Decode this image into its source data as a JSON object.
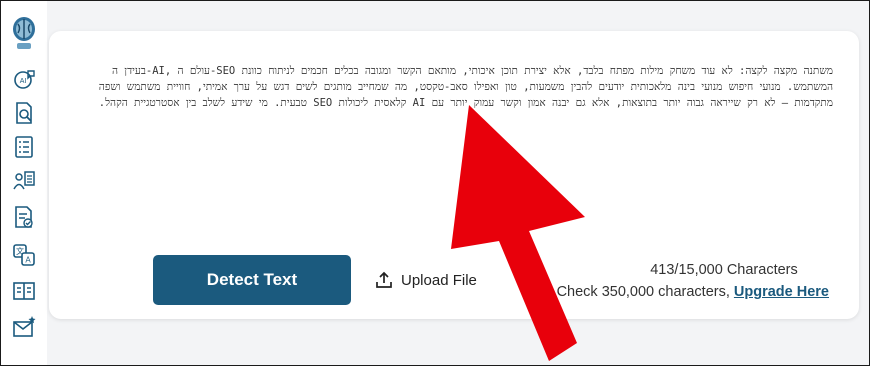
{
  "sidebar": {
    "icons": [
      {
        "name": "ai-chat-icon"
      },
      {
        "name": "document-search-icon"
      },
      {
        "name": "checklist-icon"
      },
      {
        "name": "user-document-icon"
      },
      {
        "name": "document-check-icon"
      },
      {
        "name": "translate-icon"
      },
      {
        "name": "compare-icon"
      },
      {
        "name": "mail-star-icon"
      }
    ]
  },
  "editor": {
    "text": "משתנה מקצה לקצה: לא עוד משחק מילות מפתח בלבד, אלא יצירת תוכן איכותי, מותאם הקשר ומגובה בכלים חכמים לניתוח כוונת SEO-עולם ה ,AI-בעידן ה המשתמש. מנועי חיפוש מנועי בינה מלאכותית יודעים להבין משמעות, טון ואפילו סאב-טקסט, מה שמחייב מותגים לשים דגש על ערך אמיתי, חוויית משתמש ושפה מתקדמות – לא רק שייראה גבוה יותר בתוצאות, אלא גם יבנה אמון וקשר עמוק יותר עם AI קלאסית ליכולות SEO טבעית. מי שידע לשלב בין אסטרטגיית הקהל."
  },
  "actions": {
    "detect_label": "Detect Text",
    "upload_label": "Upload File"
  },
  "counter": {
    "count_label": "413/15,000 Characters",
    "check_label": "Check 350,000 characters,",
    "upgrade_label": "Upgrade Here"
  },
  "colors": {
    "primary": "#1b5a7e",
    "annotation_arrow": "#e8000b"
  }
}
